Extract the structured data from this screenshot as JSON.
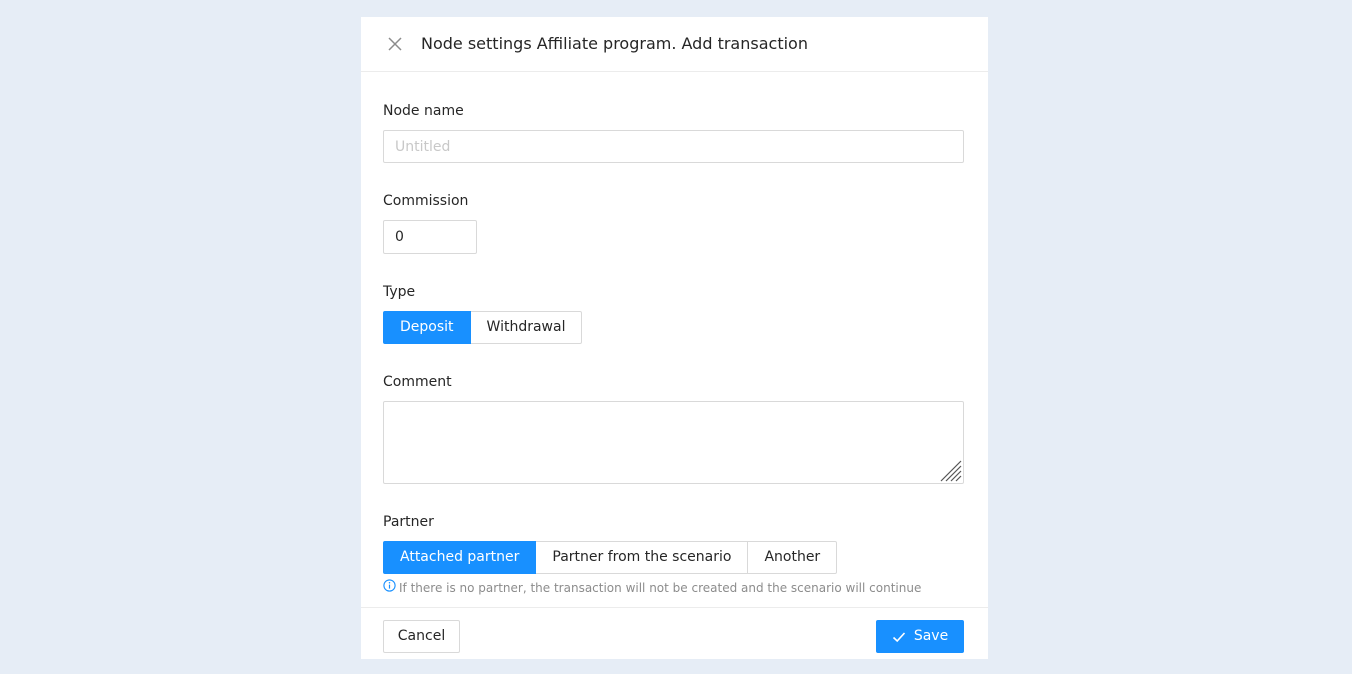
{
  "modal": {
    "title": "Node settings Affiliate program. Add transaction"
  },
  "form": {
    "node_name": {
      "label": "Node name",
      "placeholder": "Untitled",
      "value": ""
    },
    "commission": {
      "label": "Commission",
      "value": "0"
    },
    "type": {
      "label": "Type",
      "options": [
        "Deposit",
        "Withdrawal"
      ],
      "selected": "Deposit"
    },
    "comment": {
      "label": "Comment",
      "value": ""
    },
    "partner": {
      "label": "Partner",
      "options": [
        "Attached partner",
        "Partner from the scenario",
        "Another"
      ],
      "selected": "Attached partner",
      "hint": "If there is no partner, the transaction will not be created and the scenario will continue"
    }
  },
  "footer": {
    "cancel_label": "Cancel",
    "save_label": "Save"
  },
  "icons": {
    "close": "close-icon",
    "info": "info-icon",
    "check": "check-icon"
  },
  "colors": {
    "accent": "#1890ff",
    "background": "#e6edf6",
    "hint_icon": "#1890ff"
  }
}
